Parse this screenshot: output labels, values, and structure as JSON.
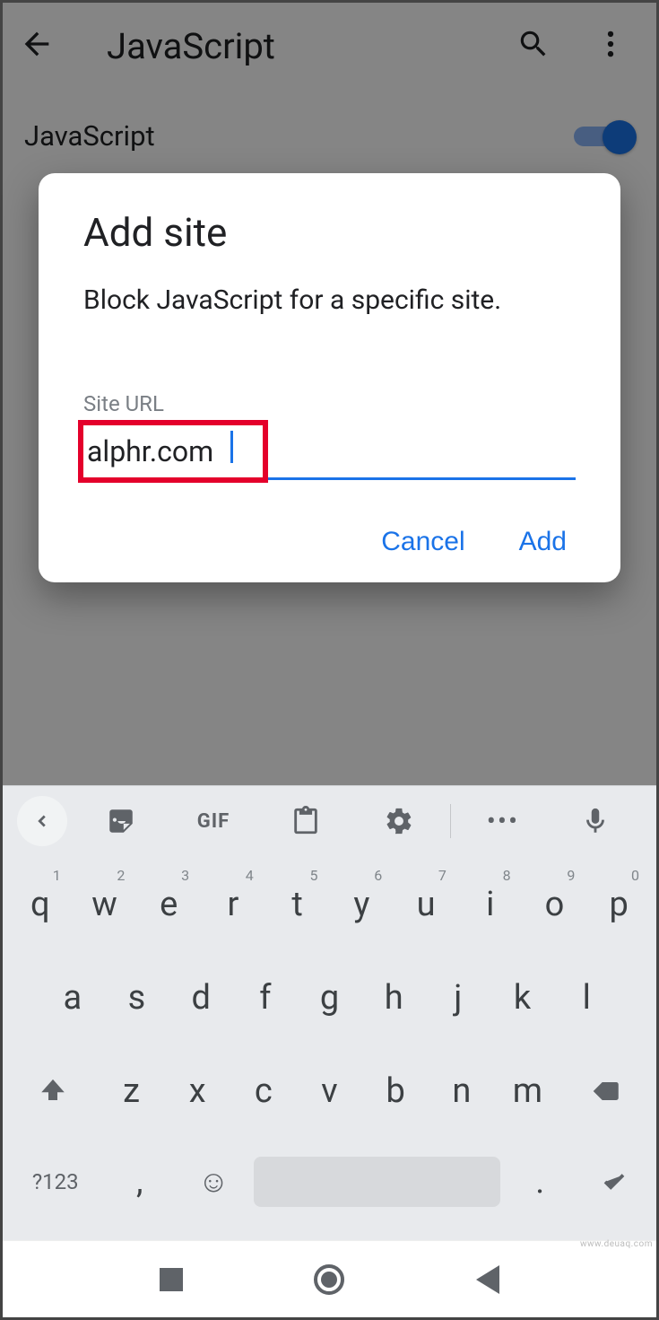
{
  "appbar": {
    "title": "JavaScript"
  },
  "setting": {
    "label": "JavaScript"
  },
  "dialog": {
    "title": "Add site",
    "body": "Block JavaScript for a specific site.",
    "field_label": "Site URL",
    "field_value": "alphr.com",
    "cancel": "Cancel",
    "add": "Add"
  },
  "keyboard": {
    "gif": "GIF",
    "toggle": "?123",
    "row1": [
      {
        "k": "q",
        "s": "1"
      },
      {
        "k": "w",
        "s": "2"
      },
      {
        "k": "e",
        "s": "3"
      },
      {
        "k": "r",
        "s": "4"
      },
      {
        "k": "t",
        "s": "5"
      },
      {
        "k": "y",
        "s": "6"
      },
      {
        "k": "u",
        "s": "7"
      },
      {
        "k": "i",
        "s": "8"
      },
      {
        "k": "o",
        "s": "9"
      },
      {
        "k": "p",
        "s": "0"
      }
    ],
    "row2": [
      "a",
      "s",
      "d",
      "f",
      "g",
      "h",
      "j",
      "k",
      "l"
    ],
    "row3": [
      "z",
      "x",
      "c",
      "v",
      "b",
      "n",
      "m"
    ],
    "comma": ",",
    "period": "."
  },
  "watermark": "www.deuaq.com"
}
